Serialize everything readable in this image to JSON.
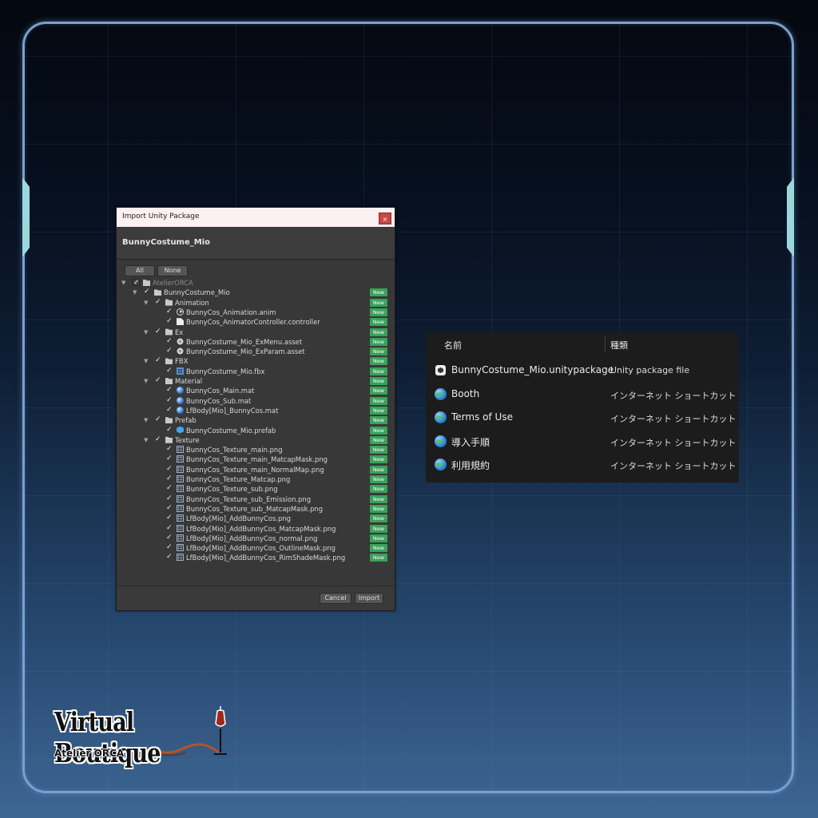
{
  "dialog": {
    "title": "Import Unity Package",
    "close_glyph": "×",
    "package_name": "BunnyCostume_Mio",
    "all_label": "All",
    "none_label": "None",
    "cancel_label": "Cancel",
    "import_label": "Import",
    "new_badge": "New",
    "tree": [
      {
        "label": "AtelierORCA",
        "depth": 0,
        "type": "folder",
        "expand": true,
        "dim": true,
        "new": false
      },
      {
        "label": "BunnyCostume_Mio",
        "depth": 1,
        "type": "folder",
        "expand": true,
        "dim": false,
        "new": true
      },
      {
        "label": "Animation",
        "depth": 2,
        "type": "folder",
        "expand": true,
        "dim": false,
        "new": true
      },
      {
        "label": "BunnyCos_Animation.anim",
        "depth": 3,
        "type": "anim",
        "expand": false,
        "dim": false,
        "new": true
      },
      {
        "label": "BunnyCos_AnimatorController.controller",
        "depth": 3,
        "type": "doc",
        "expand": false,
        "dim": false,
        "new": true
      },
      {
        "label": "Ex",
        "depth": 2,
        "type": "folder",
        "expand": true,
        "dim": false,
        "new": true
      },
      {
        "label": "BunnyCostume_Mio_ExMenu.asset",
        "depth": 3,
        "type": "asset",
        "expand": false,
        "dim": false,
        "new": true
      },
      {
        "label": "BunnyCostume_Mio_ExParam.asset",
        "depth": 3,
        "type": "asset",
        "expand": false,
        "dim": false,
        "new": true
      },
      {
        "label": "FBX",
        "depth": 2,
        "type": "folder",
        "expand": true,
        "dim": false,
        "new": true
      },
      {
        "label": "BunnyCostume_Mio.fbx",
        "depth": 3,
        "type": "fbx",
        "expand": false,
        "dim": false,
        "new": true
      },
      {
        "label": "Material",
        "depth": 2,
        "type": "folder",
        "expand": true,
        "dim": false,
        "new": true
      },
      {
        "label": "BunnyCos_Main.mat",
        "depth": 3,
        "type": "mat",
        "expand": false,
        "dim": false,
        "new": true
      },
      {
        "label": "BunnyCos_Sub.mat",
        "depth": 3,
        "type": "mat",
        "expand": false,
        "dim": false,
        "new": true
      },
      {
        "label": "LfBody[Mio]_BunnyCos.mat",
        "depth": 3,
        "type": "mat",
        "expand": false,
        "dim": false,
        "new": true
      },
      {
        "label": "Prefab",
        "depth": 2,
        "type": "folder",
        "expand": true,
        "dim": false,
        "new": true
      },
      {
        "label": "BunnyCostume_Mio.prefab",
        "depth": 3,
        "type": "prefab",
        "expand": false,
        "dim": false,
        "new": true
      },
      {
        "label": "Texture",
        "depth": 2,
        "type": "folder",
        "expand": true,
        "dim": false,
        "new": true
      },
      {
        "label": "BunnyCos_Texture_main.png",
        "depth": 3,
        "type": "png",
        "expand": false,
        "dim": false,
        "new": true
      },
      {
        "label": "BunnyCos_Texture_main_MatcapMask.png",
        "depth": 3,
        "type": "png",
        "expand": false,
        "dim": false,
        "new": true
      },
      {
        "label": "BunnyCos_Texture_main_NormalMap.png",
        "depth": 3,
        "type": "png",
        "expand": false,
        "dim": false,
        "new": true
      },
      {
        "label": "BunnyCos_Texture_Matcap.png",
        "depth": 3,
        "type": "png",
        "expand": false,
        "dim": false,
        "new": true
      },
      {
        "label": "BunnyCos_Texture_sub.png",
        "depth": 3,
        "type": "png",
        "expand": false,
        "dim": false,
        "new": true
      },
      {
        "label": "BunnyCos_Texture_sub_Emission.png",
        "depth": 3,
        "type": "png",
        "expand": false,
        "dim": false,
        "new": true
      },
      {
        "label": "BunnyCos_Texture_sub_MatcapMask.png",
        "depth": 3,
        "type": "png",
        "expand": false,
        "dim": false,
        "new": true
      },
      {
        "label": "LfBody[Mio]_AddBunnyCos.png",
        "depth": 3,
        "type": "png",
        "expand": false,
        "dim": false,
        "new": true
      },
      {
        "label": "LfBody[Mio]_AddBunnyCos_MatcapMask.png",
        "depth": 3,
        "type": "png",
        "expand": false,
        "dim": false,
        "new": true
      },
      {
        "label": "LfBody[Mio]_AddBunnyCos_normal.png",
        "depth": 3,
        "type": "png",
        "expand": false,
        "dim": false,
        "new": true
      },
      {
        "label": "LfBody[Mio]_AddBunnyCos_OutlineMask.png",
        "depth": 3,
        "type": "png",
        "expand": false,
        "dim": false,
        "new": true
      },
      {
        "label": "LfBody[Mio]_AddBunnyCos_RimShadeMask.png",
        "depth": 3,
        "type": "png",
        "expand": false,
        "dim": false,
        "new": true
      }
    ]
  },
  "explorer": {
    "col_name": "名前",
    "col_type": "種類",
    "files": [
      {
        "name": "BunnyCostume_Mio.unitypackage",
        "type": "Unity package file",
        "icon": "unity-icon"
      },
      {
        "name": "Booth",
        "type": "インターネット ショートカット",
        "icon": "globe-icon"
      },
      {
        "name": "Terms of Use",
        "type": "インターネット ショートカット",
        "icon": "globe-icon"
      },
      {
        "name": "導入手順",
        "type": "インターネット ショートカット",
        "icon": "globe-icon"
      },
      {
        "name": "利用規約",
        "type": "インターネット ショートカット",
        "icon": "globe-icon"
      }
    ]
  },
  "logo": {
    "title": "Virtual Boutique",
    "subtitle": "Atelier ORCA"
  },
  "colors": {
    "frame": "#7c9fd0",
    "side_tab": "#9ad8dd",
    "new_badge": "#39a25a",
    "close_button": "#c64747"
  }
}
